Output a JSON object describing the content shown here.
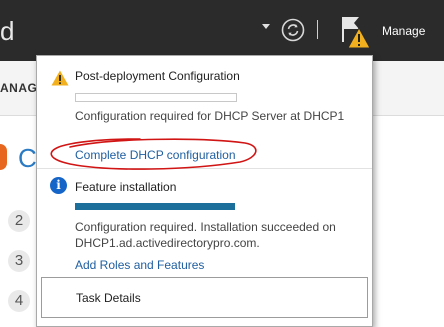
{
  "header": {
    "title_fragment": "d",
    "manage_label": "Manage",
    "icons": [
      "chevron-down-icon",
      "refresh-icon",
      "notification-flag-icon",
      "warning-icon"
    ]
  },
  "subbar": {
    "fragment": "ANAGE"
  },
  "background": {
    "heading_fragment": "C",
    "steps": [
      "2",
      "3",
      "4"
    ]
  },
  "popup": {
    "post_deployment": {
      "title": "Post-deployment Configuration",
      "progress": 0,
      "message": "Configuration required for DHCP Server at DHCP1",
      "link": "Complete DHCP configuration"
    },
    "feature_install": {
      "title": "Feature installation",
      "progress": 1,
      "message_line1": "Configuration required. Installation succeeded on",
      "message_line2": "DHCP1.ad.activedirectorypro.com.",
      "link": "Add Roles and Features"
    },
    "task_details": "Task Details"
  },
  "colors": {
    "header_bg": "#2b2b2b",
    "link": "#1f5fa0",
    "progress_fill": "#1b6f9a",
    "annotation_red": "#d11414",
    "warning_yellow": "#f2b01e",
    "info_blue": "#1565c8"
  }
}
